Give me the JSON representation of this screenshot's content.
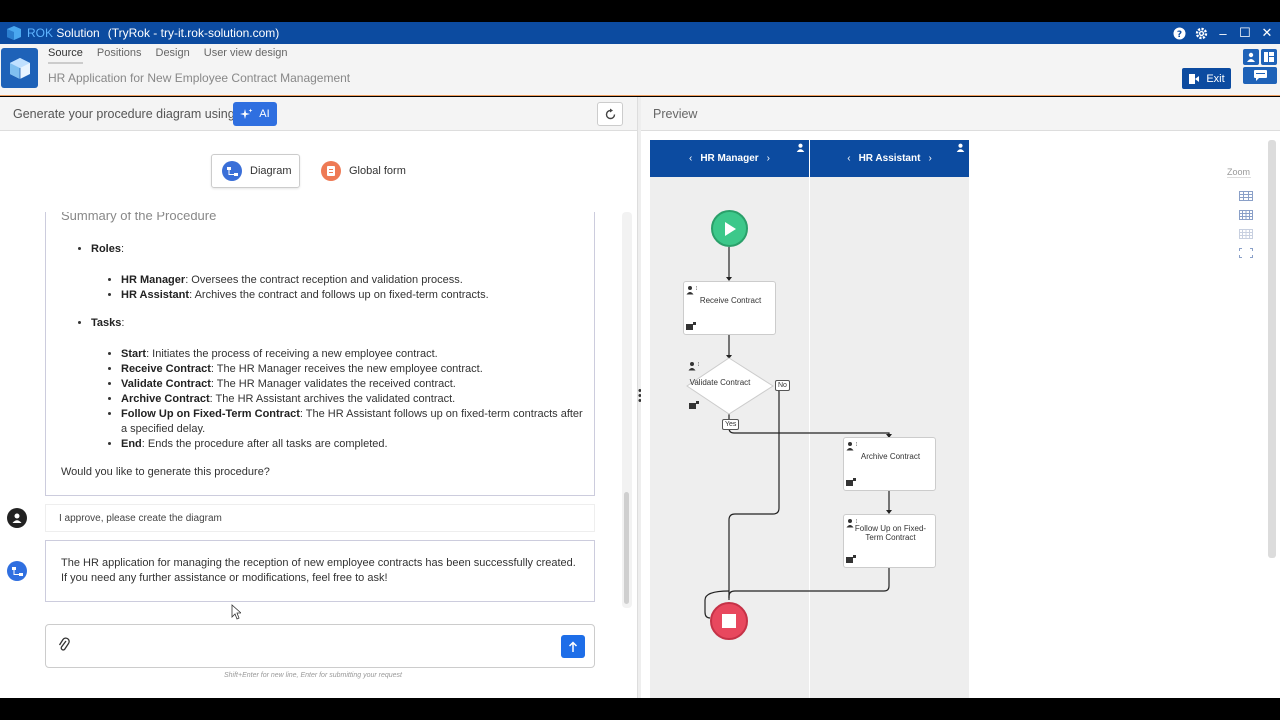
{
  "titlebar": {
    "brand_rok": "ROK",
    "brand_solution": "Solution",
    "site": "(TryRok - try-it.rok-solution.com)",
    "help_icon": "?",
    "minimize_icon": "–",
    "maximize_icon": "☐",
    "close_icon": "✕"
  },
  "header": {
    "tabs": [
      {
        "label": "Source",
        "active": true
      },
      {
        "label": "Positions",
        "active": false
      },
      {
        "label": "Design",
        "active": false
      },
      {
        "label": "User view design",
        "active": false
      }
    ],
    "procedure_title": "HR Application for New Employee Contract Management",
    "exit_label": "Exit"
  },
  "generate_bar": {
    "label": "Generate your procedure diagram using:",
    "ai_label": "AI"
  },
  "modes": {
    "diagram": "Diagram",
    "global_form": "Global form"
  },
  "summary": {
    "title": "Summary of the Procedure",
    "roles_label": "Roles",
    "roles": [
      {
        "name": "HR Manager",
        "desc": ": Oversees the contract reception and validation process."
      },
      {
        "name": "HR Assistant",
        "desc": ": Archives the contract and follows up on fixed-term contracts."
      }
    ],
    "tasks_label": "Tasks",
    "tasks": [
      {
        "name": "Start",
        "desc": ": Initiates the process of receiving a new employee contract."
      },
      {
        "name": "Receive Contract",
        "desc": ": The HR Manager receives the new employee contract."
      },
      {
        "name": "Validate Contract",
        "desc": ": The HR Manager validates the received contract."
      },
      {
        "name": "Archive Contract",
        "desc": ": The HR Assistant archives the validated contract."
      },
      {
        "name": "Follow Up on Fixed-Term Contract",
        "desc": ": The HR Assistant follows up on fixed-term contracts after a specified delay."
      },
      {
        "name": "End",
        "desc": ": Ends the procedure after all tasks are completed."
      }
    ],
    "question": "Would you like to generate this procedure?"
  },
  "chat": {
    "user_message": "I approve, please create the diagram",
    "bot_message": "The HR application for managing the reception of new employee contracts has been successfully created. If you need any further assistance or modifications, feel free to ask!",
    "input_value": "",
    "hint": "Shift+Enter for new line, Enter for submitting your request"
  },
  "preview": {
    "title": "Preview",
    "zoom_label": "Zoom",
    "lanes": [
      {
        "name": "HR Manager"
      },
      {
        "name": "HR Assistant"
      }
    ],
    "nodes": {
      "receive": "Receive Contract",
      "validate": "Validate Contract",
      "archive": "Archive Contract",
      "followup": "Follow Up on Fixed-Term Contract",
      "no_label": "No",
      "yes_label": "Yes"
    },
    "lane_nav_prev": "‹",
    "lane_nav_next": "›"
  },
  "colors": {
    "titlebar": "#0c4ba0",
    "accent": "#2f6fe0",
    "start_node": "#3cc88a",
    "end_node": "#e8485e"
  }
}
